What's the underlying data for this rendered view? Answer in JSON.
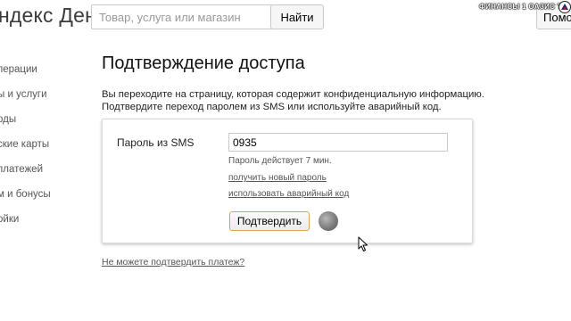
{
  "header": {
    "logo_text": "ндекс Деньги",
    "search_placeholder": "Товар, услуга или магазин",
    "search_button": "Найти",
    "watermark_text": "ФИНАНСЫ 1 ОАЗИС ТВ",
    "help_button": "Помо"
  },
  "sidebar": {
    "items": [
      {
        "label": "перации"
      },
      {
        "label": "ы и услуги"
      },
      {
        "label": "оды"
      },
      {
        "label": "ские карты"
      },
      {
        "label": " платежей"
      },
      {
        "label": "м и бонусы"
      },
      {
        "label": "ойки"
      }
    ]
  },
  "main": {
    "title": "Подтверждение доступа",
    "intro_line1": "Вы переходите на страницу, которая содержит конфиденциальную информацию.",
    "intro_line2": "Подтвердите переход паролем из SMS или используйте аварийный код.",
    "form": {
      "password_label": "Пароль из SMS",
      "password_value": "0935",
      "validity_hint": "Пароль действует  7 мин.",
      "new_password_link": "получить новый пароль",
      "emergency_code_link": "использовать аварийный код",
      "confirm_button": "Подтвердить"
    },
    "footer_link": "Не можете подтвердить платеж?"
  },
  "icons": {
    "spinner": "loading-spinner-icon",
    "cursor": "mouse-cursor-icon",
    "watermark_logo": "channel-logo-icon"
  },
  "colors": {
    "confirm_border": "#d4a94a",
    "text_muted": "#555555"
  }
}
